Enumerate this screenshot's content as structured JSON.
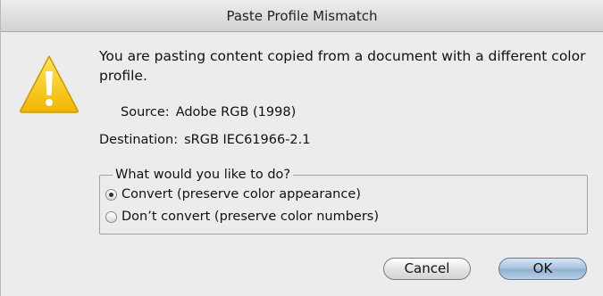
{
  "dialog": {
    "title": "Paste Profile Mismatch",
    "message": "You are pasting content copied from a document with a different color profile.",
    "source_label": "Source:",
    "source_value": "Adobe RGB (1998)",
    "destination_label": "Destination:",
    "destination_value": "sRGB IEC61966-2.1",
    "options": {
      "legend": "What would you like to do?",
      "items": [
        {
          "label": "Convert (preserve color appearance)",
          "selected": true
        },
        {
          "label": "Don’t convert (preserve color numbers)",
          "selected": false
        }
      ]
    },
    "buttons": {
      "cancel": "Cancel",
      "ok": "OK"
    },
    "icon": "warning-icon",
    "colors": {
      "warning_yellow": "#f7c400",
      "default_button_blue": "#8fb0d0"
    }
  }
}
